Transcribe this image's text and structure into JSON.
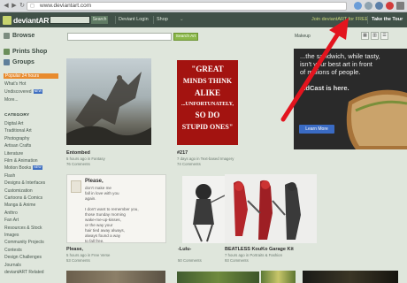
{
  "browser": {
    "url": "www.deviantart.com",
    "back_label": "◀",
    "forward_label": "▶",
    "reload_label": "↻"
  },
  "header": {
    "logo_text": "deviantART",
    "search_button": "Search",
    "links": [
      "Deviant Login",
      "Shop"
    ],
    "join_link": "Join deviantART for FREE",
    "tour_link": "Take the Tour"
  },
  "sidebar": {
    "browse": "Browse",
    "prints_shop": "Prints Shop",
    "groups": "Groups",
    "sort_items": [
      {
        "label": "Popular 24 hours",
        "badge": ""
      },
      {
        "label": "What's Hot",
        "badge": ""
      },
      {
        "label": "Undiscovered",
        "badge": "NEW"
      },
      {
        "label": "More...",
        "badge": ""
      }
    ],
    "category_title": "CATEGORY",
    "categories": [
      {
        "label": "Digital Art",
        "badge": ""
      },
      {
        "label": "Traditional Art",
        "badge": ""
      },
      {
        "label": "Photography",
        "badge": ""
      },
      {
        "label": "Artisan Crafts",
        "badge": ""
      },
      {
        "label": "Literature",
        "badge": ""
      },
      {
        "label": "Film & Animation",
        "badge": ""
      },
      {
        "label": "Motion Books",
        "badge": "NEW"
      },
      {
        "label": "Flash",
        "badge": ""
      },
      {
        "label": "Designs & Interfaces",
        "badge": ""
      },
      {
        "label": "Customization",
        "badge": ""
      },
      {
        "label": "Cartoons & Comics",
        "badge": ""
      },
      {
        "label": "Manga & Anime",
        "badge": ""
      },
      {
        "label": "Anthro",
        "badge": ""
      },
      {
        "label": "Fan Art",
        "badge": ""
      },
      {
        "label": "Resources & Stock",
        "badge": ""
      },
      {
        "label": "Images",
        "badge": ""
      },
      {
        "label": "Community Projects",
        "badge": ""
      },
      {
        "label": "Contests",
        "badge": ""
      },
      {
        "label": "Design Challenges",
        "badge": ""
      },
      {
        "label": "Journals",
        "badge": ""
      },
      {
        "label": "deviantART Related",
        "badge": ""
      }
    ]
  },
  "toolbar": {
    "search_button": "Search Art",
    "makeup_link": "Makeup",
    "view_icons": [
      "grid-small",
      "grid-large",
      "list"
    ]
  },
  "deviations": [
    {
      "title": "Entombed",
      "meta": "5 hours ago in Fantasy",
      "comments": "76 Comments"
    },
    {
      "title": "#217",
      "meta": "7 days ago in Text-based Imagery",
      "comments": "74 Comments"
    },
    {
      "title": "Please,",
      "meta": "5 hours ago in Free Verse",
      "comments": "53 Comments"
    },
    {
      "title": "-Lulu-",
      "meta": "",
      "comments": "50 Comments"
    },
    {
      "title": "BEATLESS KouKo Garage Kit",
      "meta": "7 hours ago in Portraits & Fashion",
      "comments": "93 Comments"
    }
  ],
  "poster": {
    "lines": [
      "\"GREAT",
      "MINDS THINK",
      "ALIKE",
      "...UNFORTUNATELY,",
      "SO DO",
      "STUPID ONES\""
    ]
  },
  "letter": {
    "heading": "Please,",
    "body": "don't make me\nfall in love with you\nagain.\n\nI don't want to remember you,\nthose Sunday morning\nwake-me-up-kisses,\nor the way your\nhair tied away always,\nalways found a way\nto fall free."
  },
  "ad": {
    "headline": "...the sandwich, while tasty,\nisn't your best art in front\nof millions of people.",
    "brand": "AdCast is here.",
    "cta": "Learn More"
  },
  "colors": {
    "header_bg": "#405148",
    "page_bg": "#dfe6dc",
    "active_sort": "#e88b2e",
    "search_green": "#8bb84a",
    "arrow_red": "#e3141e"
  }
}
